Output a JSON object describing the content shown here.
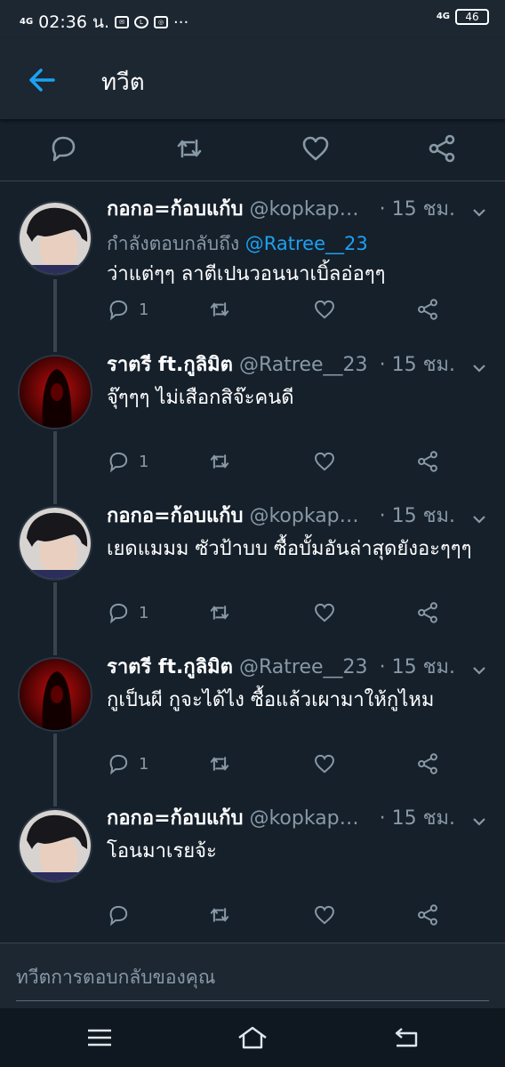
{
  "status_bar": {
    "network_left": "4G",
    "time": "02:36 น.",
    "icon_names": [
      "mail-icon",
      "line-icon",
      "instagram-icon",
      "more-icon"
    ],
    "network_right": "4G",
    "battery": "46"
  },
  "app_bar": {
    "title": "ทวีต",
    "back_icon": "arrow-left-icon"
  },
  "top_actions": [
    "reply-icon",
    "retweet-icon",
    "like-icon",
    "share-icon"
  ],
  "tweets": [
    {
      "name": "กอกอ=ก้อบแก้บ",
      "handle": "@kopkap…",
      "time": "· 15 ชม.",
      "replying_prefix": "กำลังตอบกลับถึง",
      "replying_to": "@Ratree__23",
      "text": "ว่าแต่ๆๆ ลาตีเปนวอนนาเบิ้ลอ่อๆๆ",
      "reply_count": "1",
      "avatar": "boy"
    },
    {
      "name": "ราตรี ft.กูลิมิต",
      "handle": "@Ratree__23",
      "time": "· 15 ชม.",
      "text": "จุ๊ๆๆๆ ไม่เสือกสิจ๊ะคนดี",
      "reply_count": "1",
      "avatar": "ghost"
    },
    {
      "name": "กอกอ=ก้อบแก้บ",
      "handle": "@kopkap…",
      "time": "· 15 ชม.",
      "text": "เยดแมมม ซัวป้าบบ ซื้อบั้มอันล่าสุดยังอะๆๆๆ",
      "reply_count": "1",
      "avatar": "boy"
    },
    {
      "name": "ราตรี ft.กูลิมิต",
      "handle": "@Ratree__23",
      "time": "· 15 ชม.",
      "text": "กูเป็นผี กูจะได้ไง ซื้อแล้วเผามาให้กูไหม",
      "reply_count": "1",
      "avatar": "ghost"
    },
    {
      "name": "กอกอ=ก้อบแก้บ",
      "handle": "@kopkap…",
      "time": "· 15 ชม.",
      "text": "โอนมาเรยจ้ะ",
      "reply_count": "",
      "avatar": "boy"
    }
  ],
  "reply_bar": {
    "placeholder": "ทวีตการตอบกลับของคุณ"
  },
  "nav_bar": [
    "menu-icon",
    "home-icon",
    "back-icon"
  ],
  "colors": {
    "background": "#15202b",
    "bar": "#1c2732",
    "accent": "#1da1f2",
    "muted": "#8899a6",
    "divider": "#38444d"
  }
}
